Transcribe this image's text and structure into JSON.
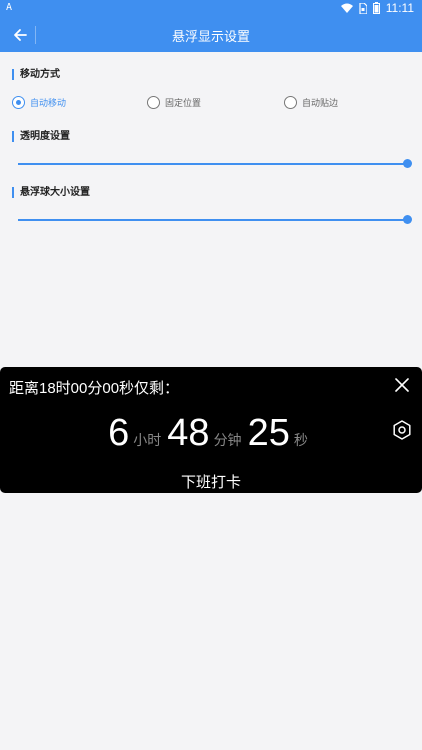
{
  "status_bar": {
    "left_badge": "A",
    "time": "11:11",
    "icons": [
      "wifi-icon",
      "sim-icon",
      "battery-icon"
    ]
  },
  "app_bar": {
    "title": "悬浮显示设置",
    "back_icon": "arrow-left-icon"
  },
  "movement": {
    "title": "移动方式",
    "options": [
      {
        "label": "自动移动",
        "selected": true
      },
      {
        "label": "固定位置",
        "selected": false
      },
      {
        "label": "自动贴边",
        "selected": false
      }
    ]
  },
  "transparency": {
    "title": "透明度设置",
    "value_fraction": 1.0
  },
  "ball_size": {
    "title": "悬浮球大小设置",
    "value_fraction": 1.0
  },
  "overlay": {
    "heading": "距离18时00分00秒仅剩：",
    "hours": "6",
    "hours_unit": "小时",
    "minutes": "48",
    "minutes_unit": "分钟",
    "seconds": "25",
    "seconds_unit": "秒",
    "footer": "下班打卡",
    "close_icon": "close-icon",
    "settings_icon": "gear-icon"
  },
  "colors": {
    "accent": "#3f8ff0",
    "background": "#f4f4f6",
    "overlay_bg": "#000000"
  }
}
